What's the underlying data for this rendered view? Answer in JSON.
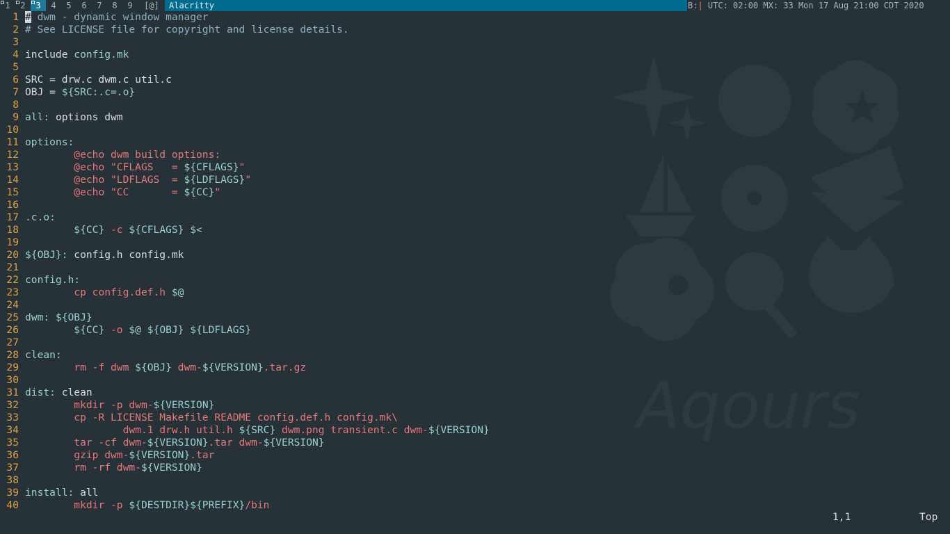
{
  "bar": {
    "tags": [
      {
        "label": "1",
        "occupied": true,
        "selected": false
      },
      {
        "label": "2",
        "occupied": true,
        "selected": false
      },
      {
        "label": "3",
        "occupied": true,
        "selected": true
      },
      {
        "label": "4",
        "occupied": false,
        "selected": false
      },
      {
        "label": "5",
        "occupied": false,
        "selected": false
      },
      {
        "label": "6",
        "occupied": false,
        "selected": false
      },
      {
        "label": "7",
        "occupied": false,
        "selected": false
      },
      {
        "label": "8",
        "occupied": false,
        "selected": false
      },
      {
        "label": "9",
        "occupied": false,
        "selected": false
      }
    ],
    "layout": "[@]",
    "window_title": "Alacritty",
    "status_prefix": "B:",
    "status_sep": "|",
    "status_text": " UTC: 02:00 MX: 33 Mon 17 Aug 21:00 CDT 2020"
  },
  "editor": {
    "lines": [
      {
        "n": "1",
        "segs": [
          {
            "t": "#",
            "c": "cursor"
          },
          {
            "t": " dwm - dynamic window manager",
            "c": "c-cmt"
          }
        ]
      },
      {
        "n": "2",
        "segs": [
          {
            "t": "# See LICENSE file for copyright and license details.",
            "c": "c-cmt"
          }
        ]
      },
      {
        "n": "3",
        "segs": []
      },
      {
        "n": "4",
        "segs": [
          {
            "t": "include ",
            "c": "c-txt"
          },
          {
            "t": "config.mk",
            "c": "c-var"
          }
        ]
      },
      {
        "n": "5",
        "segs": []
      },
      {
        "n": "6",
        "segs": [
          {
            "t": "SRC = drw.c dwm.c util.c",
            "c": "c-txt"
          }
        ]
      },
      {
        "n": "7",
        "segs": [
          {
            "t": "OBJ = ",
            "c": "c-txt"
          },
          {
            "t": "${SRC:.c=.o}",
            "c": "c-var"
          }
        ]
      },
      {
        "n": "8",
        "segs": []
      },
      {
        "n": "9",
        "segs": [
          {
            "t": "all:",
            "c": "c-var"
          },
          {
            "t": " options dwm",
            "c": "c-txt"
          }
        ]
      },
      {
        "n": "10",
        "segs": []
      },
      {
        "n": "11",
        "segs": [
          {
            "t": "options:",
            "c": "c-var"
          }
        ]
      },
      {
        "n": "12",
        "segs": [
          {
            "t": "        ",
            "c": "c-txt"
          },
          {
            "t": "@echo dwm build options:",
            "c": "c-cmd"
          }
        ]
      },
      {
        "n": "13",
        "segs": [
          {
            "t": "        ",
            "c": "c-txt"
          },
          {
            "t": "@echo \"CFLAGS   = ",
            "c": "c-cmd"
          },
          {
            "t": "${CFLAGS}",
            "c": "c-var"
          },
          {
            "t": "\"",
            "c": "c-cmd"
          }
        ]
      },
      {
        "n": "14",
        "segs": [
          {
            "t": "        ",
            "c": "c-txt"
          },
          {
            "t": "@echo \"LDFLAGS  = ",
            "c": "c-cmd"
          },
          {
            "t": "${LDFLAGS}",
            "c": "c-var"
          },
          {
            "t": "\"",
            "c": "c-cmd"
          }
        ]
      },
      {
        "n": "15",
        "segs": [
          {
            "t": "        ",
            "c": "c-txt"
          },
          {
            "t": "@echo \"CC       = ",
            "c": "c-cmd"
          },
          {
            "t": "${CC}",
            "c": "c-var"
          },
          {
            "t": "\"",
            "c": "c-cmd"
          }
        ]
      },
      {
        "n": "16",
        "segs": []
      },
      {
        "n": "17",
        "segs": [
          {
            "t": ".c.o:",
            "c": "c-var"
          }
        ]
      },
      {
        "n": "18",
        "segs": [
          {
            "t": "        ",
            "c": "c-txt"
          },
          {
            "t": "${CC}",
            "c": "c-var"
          },
          {
            "t": " -c ",
            "c": "c-cmd"
          },
          {
            "t": "${CFLAGS}",
            "c": "c-var"
          },
          {
            "t": " $<",
            "c": "c-var"
          }
        ]
      },
      {
        "n": "19",
        "segs": []
      },
      {
        "n": "20",
        "segs": [
          {
            "t": "${OBJ}",
            "c": "c-var"
          },
          {
            "t": ":",
            "c": "c-var"
          },
          {
            "t": " config.h config.mk",
            "c": "c-txt"
          }
        ]
      },
      {
        "n": "21",
        "segs": []
      },
      {
        "n": "22",
        "segs": [
          {
            "t": "config.h:",
            "c": "c-var"
          }
        ]
      },
      {
        "n": "23",
        "segs": [
          {
            "t": "        ",
            "c": "c-txt"
          },
          {
            "t": "cp config.def.h ",
            "c": "c-cmd"
          },
          {
            "t": "$@",
            "c": "c-var"
          }
        ]
      },
      {
        "n": "24",
        "segs": []
      },
      {
        "n": "25",
        "segs": [
          {
            "t": "dwm:",
            "c": "c-var"
          },
          {
            "t": " ",
            "c": "c-txt"
          },
          {
            "t": "${OBJ}",
            "c": "c-var"
          }
        ]
      },
      {
        "n": "26",
        "segs": [
          {
            "t": "        ",
            "c": "c-txt"
          },
          {
            "t": "${CC}",
            "c": "c-var"
          },
          {
            "t": " -o ",
            "c": "c-cmd"
          },
          {
            "t": "$@ ${OBJ} ${LDFLAGS}",
            "c": "c-var"
          }
        ]
      },
      {
        "n": "27",
        "segs": []
      },
      {
        "n": "28",
        "segs": [
          {
            "t": "clean:",
            "c": "c-var"
          }
        ]
      },
      {
        "n": "29",
        "segs": [
          {
            "t": "        ",
            "c": "c-txt"
          },
          {
            "t": "rm -f dwm ",
            "c": "c-cmd"
          },
          {
            "t": "${OBJ}",
            "c": "c-var"
          },
          {
            "t": " dwm-",
            "c": "c-cmd"
          },
          {
            "t": "${VERSION}",
            "c": "c-var"
          },
          {
            "t": ".tar.gz",
            "c": "c-cmd"
          }
        ]
      },
      {
        "n": "30",
        "segs": []
      },
      {
        "n": "31",
        "segs": [
          {
            "t": "dist:",
            "c": "c-var"
          },
          {
            "t": " clean",
            "c": "c-txt"
          }
        ]
      },
      {
        "n": "32",
        "segs": [
          {
            "t": "        ",
            "c": "c-txt"
          },
          {
            "t": "mkdir -p dwm-",
            "c": "c-cmd"
          },
          {
            "t": "${VERSION}",
            "c": "c-var"
          }
        ]
      },
      {
        "n": "33",
        "segs": [
          {
            "t": "        ",
            "c": "c-txt"
          },
          {
            "t": "cp -R LICENSE Makefile README config.def.h config.mk\\",
            "c": "c-cmd"
          }
        ]
      },
      {
        "n": "34",
        "segs": [
          {
            "t": "                ",
            "c": "c-txt"
          },
          {
            "t": "dwm.1 drw.h util.h ",
            "c": "c-cmd"
          },
          {
            "t": "${SRC}",
            "c": "c-var"
          },
          {
            "t": " dwm.png transient.c dwm-",
            "c": "c-cmd"
          },
          {
            "t": "${VERSION}",
            "c": "c-var"
          }
        ]
      },
      {
        "n": "35",
        "segs": [
          {
            "t": "        ",
            "c": "c-txt"
          },
          {
            "t": "tar -cf dwm-",
            "c": "c-cmd"
          },
          {
            "t": "${VERSION}",
            "c": "c-var"
          },
          {
            "t": ".tar dwm-",
            "c": "c-cmd"
          },
          {
            "t": "${VERSION}",
            "c": "c-var"
          }
        ]
      },
      {
        "n": "36",
        "segs": [
          {
            "t": "        ",
            "c": "c-txt"
          },
          {
            "t": "gzip dwm-",
            "c": "c-cmd"
          },
          {
            "t": "${VERSION}",
            "c": "c-var"
          },
          {
            "t": ".tar",
            "c": "c-cmd"
          }
        ]
      },
      {
        "n": "37",
        "segs": [
          {
            "t": "        ",
            "c": "c-txt"
          },
          {
            "t": "rm -rf dwm-",
            "c": "c-cmd"
          },
          {
            "t": "${VERSION}",
            "c": "c-var"
          }
        ]
      },
      {
        "n": "38",
        "segs": []
      },
      {
        "n": "39",
        "segs": [
          {
            "t": "install:",
            "c": "c-var"
          },
          {
            "t": " all",
            "c": "c-txt"
          }
        ]
      },
      {
        "n": "40",
        "segs": [
          {
            "t": "        ",
            "c": "c-txt"
          },
          {
            "t": "mkdir -p ",
            "c": "c-cmd"
          },
          {
            "t": "${DESTDIR}${PREFIX}",
            "c": "c-var"
          },
          {
            "t": "/bin",
            "c": "c-cmd"
          }
        ]
      }
    ],
    "ruler": "1,1",
    "scroll_pos": "Top"
  },
  "wallpaper": {
    "logo_text": "Aqours"
  }
}
